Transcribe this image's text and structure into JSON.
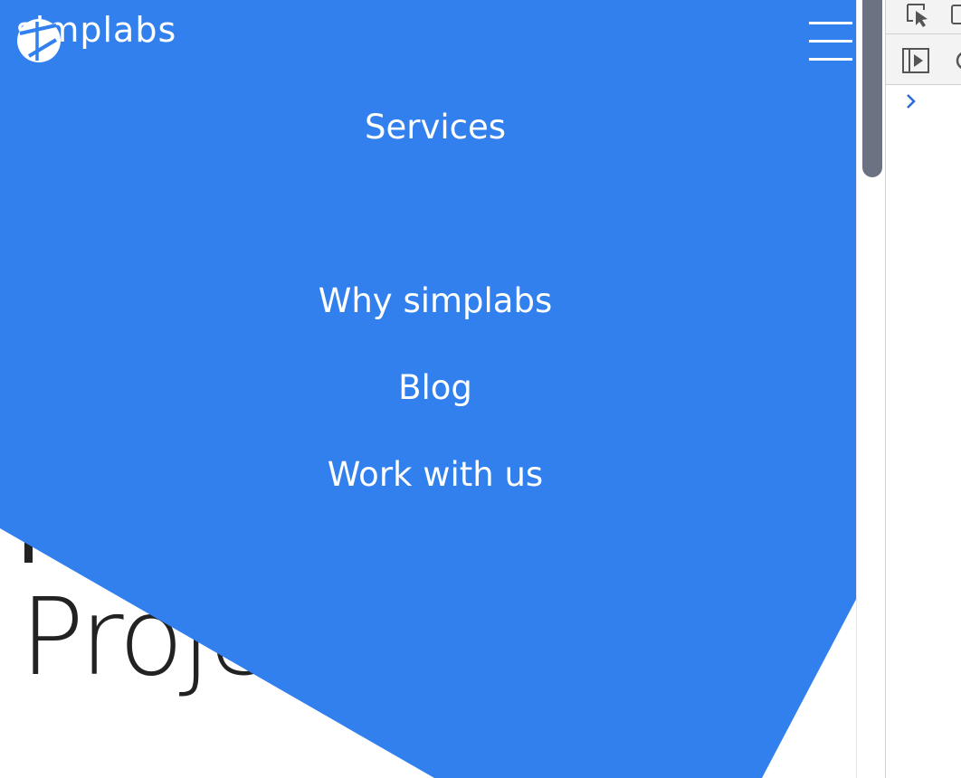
{
  "header": {
    "logo_text": "simplabs"
  },
  "nav": {
    "items": [
      {
        "label": "Services"
      },
      {
        "label": "Why simplabs"
      },
      {
        "label": "Blog"
      },
      {
        "label": "Work with us"
      }
    ]
  },
  "hero": {
    "heading_visible": "Proje"
  },
  "colors": {
    "menu_background": "#3180ee",
    "text_white": "#ffffff",
    "hero_text": "#222222",
    "scrollbar_thumb": "#6b7383",
    "devtools_accent": "#2a6ad8"
  },
  "icons": {
    "logo": "simplabs-logo-icon",
    "menu": "hamburger-menu-icon",
    "inspect": "inspect-element-icon",
    "device": "device-toolbar-icon",
    "sidebar": "show-sidebar-icon",
    "clear": "clear-console-icon",
    "prompt": "chevron-right-icon"
  }
}
